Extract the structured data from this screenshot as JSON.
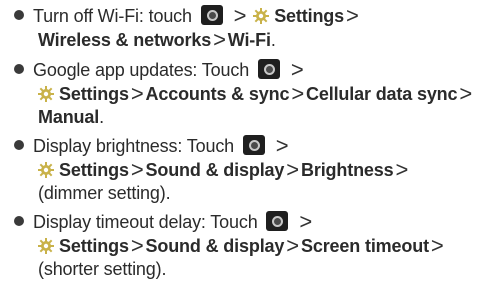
{
  "icons": {
    "app_icon": "app-launcher-icon",
    "settings_icon": "gear-icon",
    "gear_color": "#c9b24a"
  },
  "separator": ">",
  "items": [
    {
      "label": "Turn off Wi-Fi: touch",
      "settings": "Settings",
      "path1": "Wireless & networks",
      "path2": "Wi-Fi"
    },
    {
      "label": "Google app updates: Touch",
      "settings": "Settings",
      "path1": "Accounts & sync",
      "path2": "Cellular data sync",
      "path3": "Manual"
    },
    {
      "label": "Display brightness: Touch",
      "settings": "Settings",
      "path1": "Sound & display",
      "path2": "Brightness",
      "note": "(dimmer setting)."
    },
    {
      "label": "Display timeout delay: Touch",
      "settings": "Settings",
      "path1": "Sound & display",
      "path2": "Screen timeout",
      "note": "(shorter setting)."
    }
  ]
}
